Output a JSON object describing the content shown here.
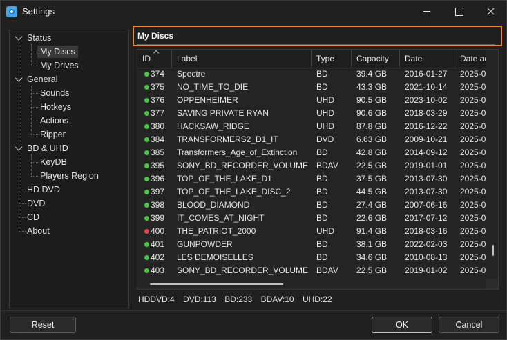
{
  "window": {
    "title": "Settings"
  },
  "tree": {
    "items": [
      {
        "label": "Status",
        "expanded": true
      },
      {
        "label": "My Discs",
        "selected": true
      },
      {
        "label": "My Drives"
      },
      {
        "label": "General",
        "expanded": true
      },
      {
        "label": "Sounds"
      },
      {
        "label": "Hotkeys"
      },
      {
        "label": "Actions"
      },
      {
        "label": "Ripper"
      },
      {
        "label": "BD & UHD",
        "expanded": true
      },
      {
        "label": "KeyDB"
      },
      {
        "label": "Players Region"
      },
      {
        "label": "HD DVD"
      },
      {
        "label": "DVD"
      },
      {
        "label": "CD"
      },
      {
        "label": "About"
      }
    ]
  },
  "panel": {
    "title": "My Discs"
  },
  "grid": {
    "columns": [
      "ID",
      "Label",
      "Type",
      "Capacity",
      "Date",
      "Date ac"
    ],
    "rows": [
      {
        "status": "green",
        "id": "374",
        "label": "Spectre",
        "type": "BD",
        "capacity": "39.4 GB",
        "date": "2016-01-27",
        "date_added": "2025-0"
      },
      {
        "status": "green",
        "id": "375",
        "label": "NO_TIME_TO_DIE",
        "type": "BD",
        "capacity": "43.3 GB",
        "date": "2021-10-14",
        "date_added": "2025-0"
      },
      {
        "status": "green",
        "id": "376",
        "label": "OPPENHEIMER",
        "type": "UHD",
        "capacity": "90.5 GB",
        "date": "2023-10-02",
        "date_added": "2025-0"
      },
      {
        "status": "green",
        "id": "377",
        "label": "SAVING PRIVATE RYAN",
        "type": "UHD",
        "capacity": "90.6 GB",
        "date": "2018-03-29",
        "date_added": "2025-0"
      },
      {
        "status": "green",
        "id": "380",
        "label": "HACKSAW_RIDGE",
        "type": "UHD",
        "capacity": "87.8 GB",
        "date": "2016-12-22",
        "date_added": "2025-0"
      },
      {
        "status": "green",
        "id": "384",
        "label": "TRANSFORMERS2_D1_IT",
        "type": "DVD",
        "capacity": "6.63 GB",
        "date": "2009-10-21",
        "date_added": "2025-0"
      },
      {
        "status": "green",
        "id": "385",
        "label": "Transformers_Age_of_Extinction",
        "type": "BD",
        "capacity": "42.8 GB",
        "date": "2014-09-12",
        "date_added": "2025-0"
      },
      {
        "status": "green",
        "id": "395",
        "label": "SONY_BD_RECORDER_VOLUME",
        "type": "BDAV",
        "capacity": "22.5 GB",
        "date": "2019-01-01",
        "date_added": "2025-0"
      },
      {
        "status": "green",
        "id": "396",
        "label": "TOP_OF_THE_LAKE_D1",
        "type": "BD",
        "capacity": "37.5 GB",
        "date": "2013-07-30",
        "date_added": "2025-0"
      },
      {
        "status": "green",
        "id": "397",
        "label": "TOP_OF_THE_LAKE_DISC_2",
        "type": "BD",
        "capacity": "44.5 GB",
        "date": "2013-07-30",
        "date_added": "2025-0"
      },
      {
        "status": "green",
        "id": "398",
        "label": "BLOOD_DIAMOND",
        "type": "BD",
        "capacity": "27.4 GB",
        "date": "2007-06-16",
        "date_added": "2025-0"
      },
      {
        "status": "green",
        "id": "399",
        "label": "IT_COMES_AT_NIGHT",
        "type": "BD",
        "capacity": "22.6 GB",
        "date": "2017-07-12",
        "date_added": "2025-0"
      },
      {
        "status": "red",
        "id": "400",
        "label": "THE_PATRIOT_2000",
        "type": "UHD",
        "capacity": "91.4 GB",
        "date": "2018-03-16",
        "date_added": "2025-0"
      },
      {
        "status": "green",
        "id": "401",
        "label": "GUNPOWDER",
        "type": "BD",
        "capacity": "38.1 GB",
        "date": "2022-02-03",
        "date_added": "2025-0"
      },
      {
        "status": "green",
        "id": "402",
        "label": "LES DEMOISELLES",
        "type": "BD",
        "capacity": "34.6 GB",
        "date": "2010-08-13",
        "date_added": "2025-0"
      },
      {
        "status": "green",
        "id": "403",
        "label": "SONY_BD_RECORDER_VOLUME",
        "type": "BDAV",
        "capacity": "22.5 GB",
        "date": "2019-01-02",
        "date_added": "2025-0"
      }
    ]
  },
  "stats": [
    "HDDVD:4",
    "DVD:113",
    "BD:233",
    "BDAV:10",
    "UHD:22"
  ],
  "buttons": {
    "reset": "Reset",
    "ok": "OK",
    "cancel": "Cancel"
  },
  "colors": {
    "accent": "#f08a24",
    "status_green": "#4cc24c",
    "status_red": "#e04848"
  },
  "icons": {
    "app": "eye-icon",
    "minimize": "minimize-icon",
    "maximize": "maximize-icon",
    "close": "close-icon"
  }
}
